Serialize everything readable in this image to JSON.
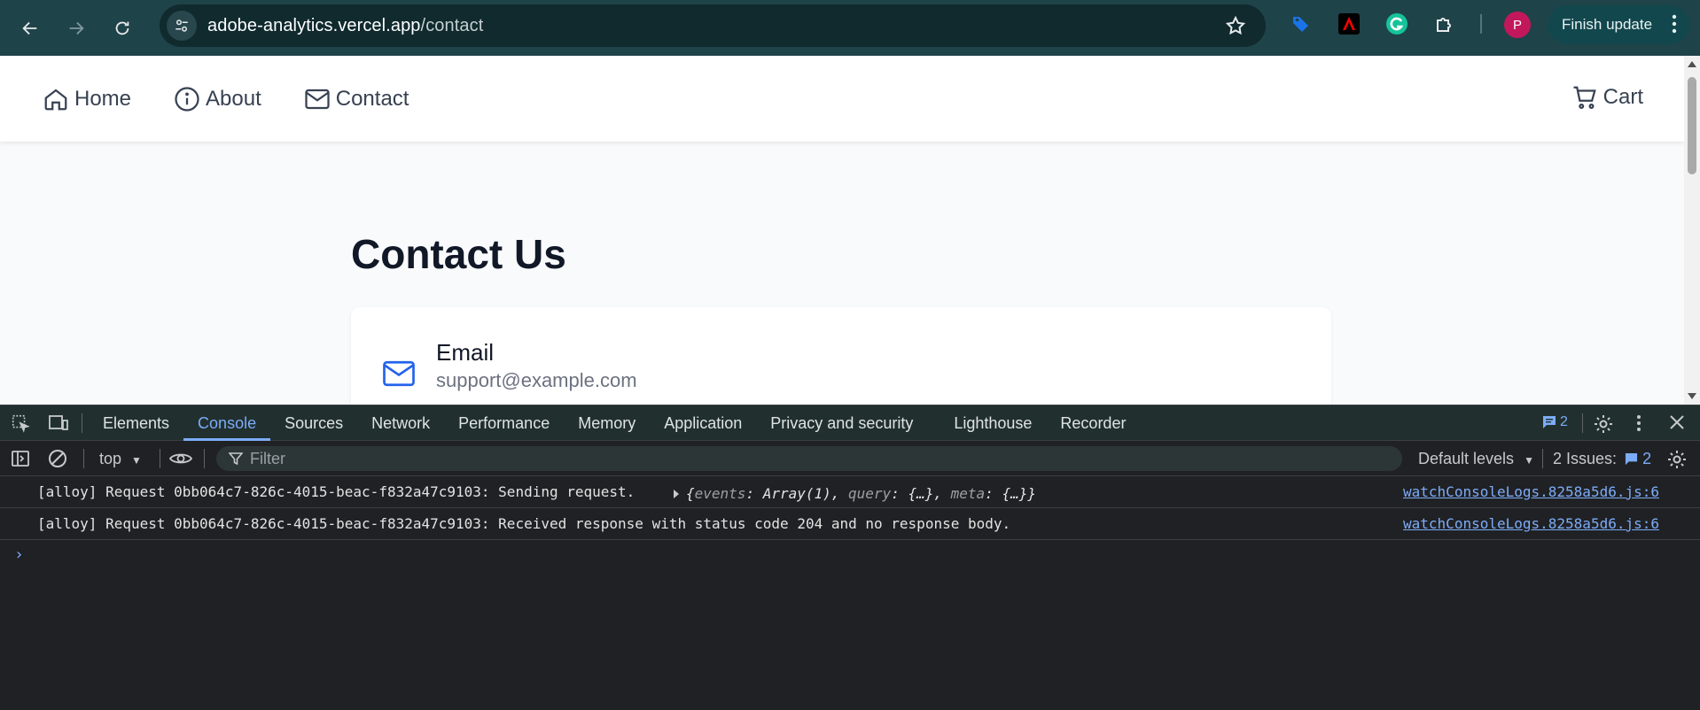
{
  "browser": {
    "url_host": "adobe-analytics.vercel.app",
    "url_path": "/contact",
    "profile_initial": "P",
    "finish_update_label": "Finish update"
  },
  "site": {
    "nav": [
      {
        "label": "Home",
        "icon": "home-icon"
      },
      {
        "label": "About",
        "icon": "info-icon"
      },
      {
        "label": "Contact",
        "icon": "mail-icon"
      }
    ],
    "cart_label": "Cart",
    "title": "Contact Us",
    "card": {
      "label": "Email",
      "value": "support@example.com"
    }
  },
  "devtools": {
    "tabs": [
      "Elements",
      "Console",
      "Sources",
      "Network",
      "Performance",
      "Memory",
      "Application",
      "Privacy and security",
      "Lighthouse",
      "Recorder"
    ],
    "active_tab": "Console",
    "issues_badge_count": "2",
    "context": "top",
    "filter_placeholder": "Filter",
    "levels_label": "Default levels",
    "issues_label": "2 Issues:",
    "issues_count": "2",
    "logs": [
      {
        "message": "[alloy] Request 0bb064c7-826c-4015-beac-f832a47c9103: Sending request.",
        "object": {
          "k1": "events",
          "v1": "Array(1)",
          "k2": "query",
          "v2": "{…}",
          "k3": "meta",
          "v3": "{…}"
        },
        "source": "watchConsoleLogs.8258a5d6.js:6"
      },
      {
        "message": "[alloy] Request 0bb064c7-826c-4015-beac-f832a47c9103: Received response with status code 204 and no response body.",
        "source": "watchConsoleLogs.8258a5d6.js:6"
      }
    ],
    "prompt": "›"
  }
}
